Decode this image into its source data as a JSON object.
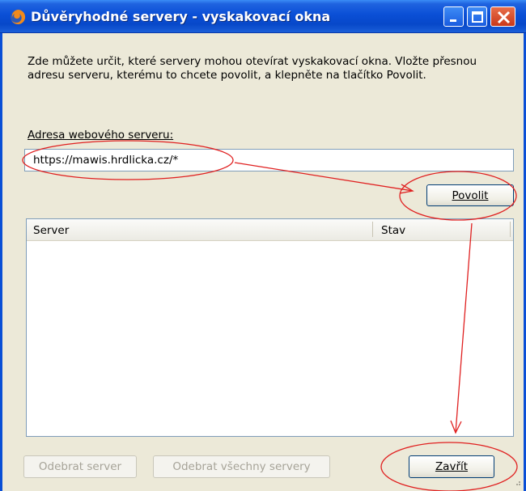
{
  "window": {
    "title": "Důvěryhodné servery - vyskakovací okna",
    "icon": "firefox-icon"
  },
  "titlebar_buttons": [
    "minimize",
    "maximize",
    "close"
  ],
  "description": "Zde můžete určit, které servery mohou otevírat vyskakovací okna. Vložte přesnou adresu serveru, kterému to chcete povolit, a klepněte na tlačítko Povolit.",
  "address": {
    "label": "Adresa webového serveru:",
    "value": "https://mawis.hrdlicka.cz/*"
  },
  "buttons": {
    "allow": "Povolit",
    "remove": "Odebrat server",
    "remove_all": "Odebrat všechny servery",
    "close": "Zavřít"
  },
  "list": {
    "columns": [
      "Server",
      "Stav"
    ],
    "rows": []
  },
  "annotation_color": "#e02020"
}
